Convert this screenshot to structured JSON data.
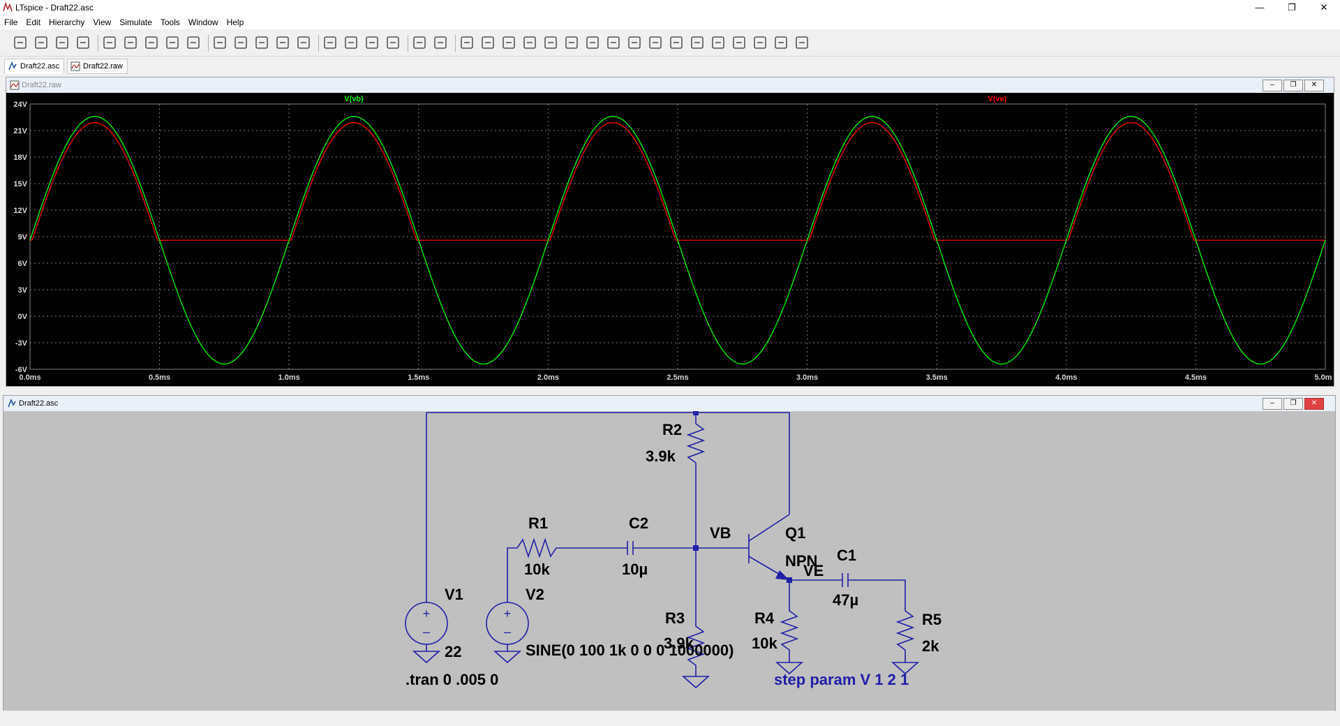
{
  "window": {
    "title": "LTspice - Draft22.asc"
  },
  "menu": [
    "File",
    "Edit",
    "Hierarchy",
    "View",
    "Simulate",
    "Tools",
    "Window",
    "Help"
  ],
  "toolbar_icons": [
    "run-icon",
    "open-icon",
    "save-icon",
    "control-panel-icon",
    "halt-icon",
    "pan-icon",
    "zoom-in-icon",
    "zoom-area-icon",
    "zoom-out-icon",
    "zoom-fit-icon",
    "autorange-icon",
    "marker-icon",
    "tile-horizontal-icon",
    "tile-vertical-icon",
    "cascade-icon",
    "cut-icon",
    "copy-icon",
    "paste-icon",
    "find-icon",
    "print-icon",
    "print-preview-icon",
    "wire-icon",
    "ground-icon",
    "label-net-icon",
    "resistor-icon",
    "capacitor-icon",
    "inductor-icon",
    "diode-icon",
    "component-icon",
    "move-icon",
    "drag-icon",
    "undo-icon",
    "redo-icon",
    "rotate-icon",
    "mirror-icon",
    "text-icon",
    "spice-directive-icon"
  ],
  "tabs": [
    {
      "label": "Draft22.asc",
      "icon": "schematic-icon"
    },
    {
      "label": "Draft22.raw",
      "icon": "waveform-icon"
    }
  ],
  "plot_window": {
    "title": "Draft22.raw",
    "chart_data": {
      "type": "line",
      "series": [
        {
          "name": "V(vb)",
          "color": "#00ff00"
        },
        {
          "name": "V(ve)",
          "color": "#ff0000"
        }
      ],
      "ytick_labels": [
        "24V",
        "21V",
        "18V",
        "15V",
        "12V",
        "9V",
        "6V",
        "3V",
        "0V",
        "-3V",
        "-6V"
      ],
      "xtick_labels": [
        "0.0ms",
        "0.5ms",
        "1.0ms",
        "1.5ms",
        "2.0ms",
        "2.5ms",
        "3.0ms",
        "3.5ms",
        "4.0ms",
        "4.5ms",
        "5.0ms"
      ],
      "xlim": [
        0,
        5
      ],
      "ylim": [
        -6,
        24
      ],
      "x_unit": "ms",
      "y_unit": "V",
      "vb": {
        "offset": 8.6,
        "amplitude": 14.0,
        "clip_high": 22.8,
        "min": -5.4,
        "freq_per_ms": 1
      },
      "ve": {
        "high": 21.9,
        "low": 8.6,
        "follow_offset": -0.7
      },
      "grid": true
    }
  },
  "schematic_window": {
    "title": "Draft22.asc",
    "labels": {
      "r2_name": "R2",
      "r2_value": "3.9k",
      "r1_name": "R1",
      "r1_value": "10k",
      "c2_name": "C2",
      "c2_value": "10µ",
      "vb": "VB",
      "q1_name": "Q1",
      "q1_model": "NPN",
      "c1_name": "C1",
      "c1_value": "47µ",
      "ve": "VE",
      "v1_name": "V1",
      "v1_value": "22",
      "v2_name": "V2",
      "v2_value": "SINE(0 100 1k 0 0 0 1000000)",
      "r3_name": "R3",
      "r3_value": "3.9k",
      "r4_name": "R4",
      "r4_value": "10k",
      "r5_name": "R5",
      "r5_value": "2k",
      "tran": ".tran 0 .005 0",
      "step": "step param V 1 2 1"
    }
  }
}
